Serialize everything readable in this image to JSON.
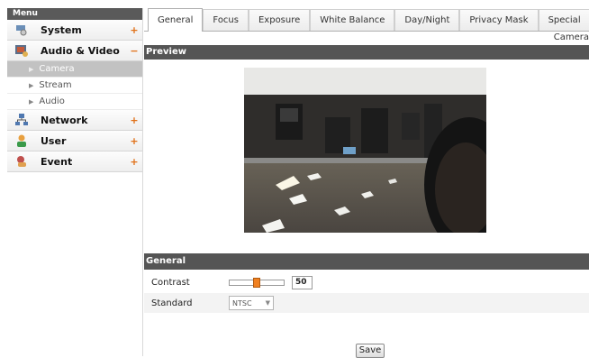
{
  "sidebar": {
    "title": "Menu",
    "categories": [
      {
        "label": "System",
        "toggle": "+",
        "icon": "wrench-icon"
      },
      {
        "label": "Audio & Video",
        "toggle": "−",
        "icon": "camera-icon"
      },
      {
        "label": "Network",
        "toggle": "+",
        "icon": "network-icon"
      },
      {
        "label": "User",
        "toggle": "+",
        "icon": "user-icon"
      },
      {
        "label": "Event",
        "toggle": "+",
        "icon": "event-icon"
      }
    ],
    "subitems": [
      {
        "label": "Camera",
        "active": true
      },
      {
        "label": "Stream",
        "active": false
      },
      {
        "label": "Audio",
        "active": false
      }
    ]
  },
  "tabs": [
    "General",
    "Focus",
    "Exposure",
    "White Balance",
    "Day/Night",
    "Privacy Mask",
    "Special"
  ],
  "active_tab": "General",
  "page_label": "Camera",
  "preview": {
    "title": "Preview"
  },
  "general": {
    "title": "General",
    "contrast_label": "Contrast",
    "contrast_value": "50",
    "standard_label": "Standard",
    "standard_value": "NTSC"
  },
  "save_label": "Save",
  "colors": {
    "accent": "#f08020",
    "header_bar": "#555555",
    "active_subitem": "#c2c2c2"
  }
}
